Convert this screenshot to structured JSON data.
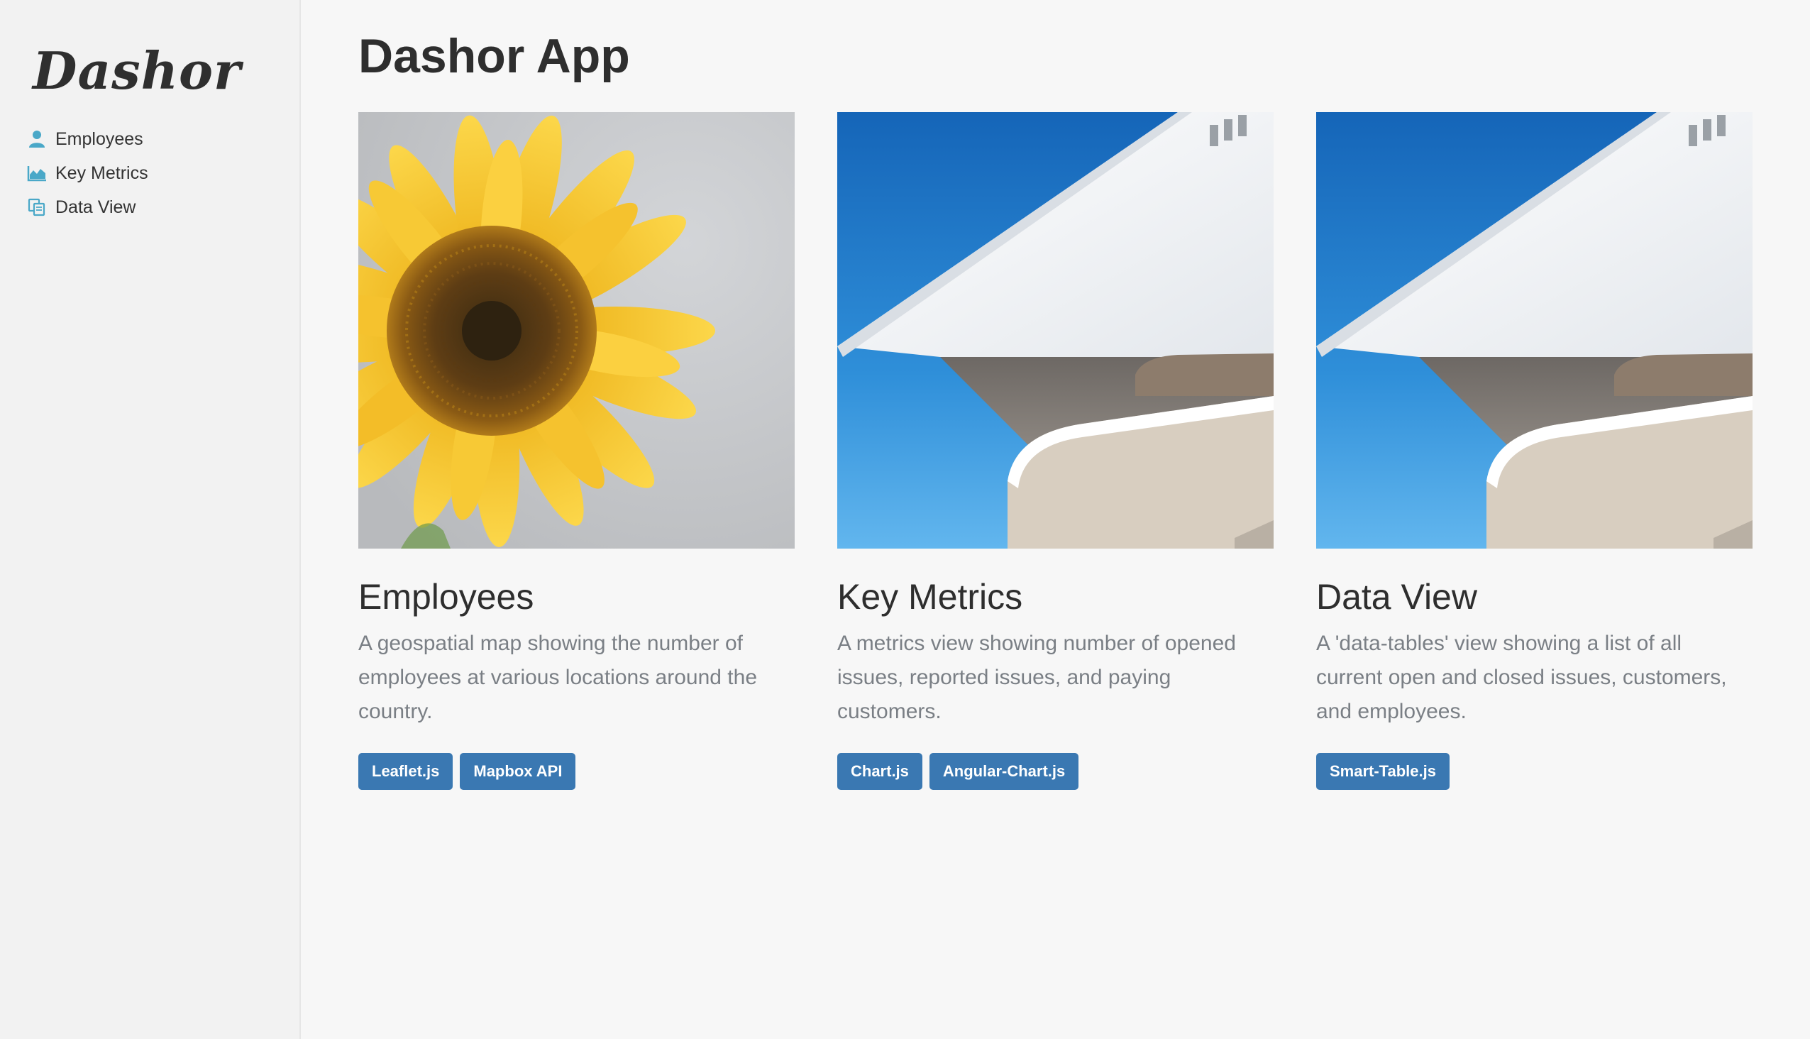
{
  "sidebar": {
    "logo": "Dashor",
    "items": [
      {
        "label": "Employees",
        "icon": "user-icon"
      },
      {
        "label": "Key Metrics",
        "icon": "area-chart-icon"
      },
      {
        "label": "Data View",
        "icon": "copy-icon"
      }
    ]
  },
  "main": {
    "title": "Dashor App",
    "cards": [
      {
        "title": "Employees",
        "description": "A geospatial map showing the number of employees at various locations around the country.",
        "image": "sunflower-photo",
        "tags": [
          "Leaflet.js",
          "Mapbox API"
        ]
      },
      {
        "title": "Key Metrics",
        "description": "A metrics view showing number of opened issues, reported issues, and paying customers.",
        "image": "architecture-photo",
        "tags": [
          "Chart.js",
          "Angular-Chart.js"
        ]
      },
      {
        "title": "Data View",
        "description": "A 'data-tables' view showing a list of all current open and closed issues, customers, and employees.",
        "image": "architecture-photo",
        "tags": [
          "Smart-Table.js"
        ]
      }
    ]
  },
  "colors": {
    "accent": "#3a78b2",
    "icon": "#4aa8c8",
    "background": "#f7f7f7",
    "sidebar": "#f2f2f2"
  }
}
